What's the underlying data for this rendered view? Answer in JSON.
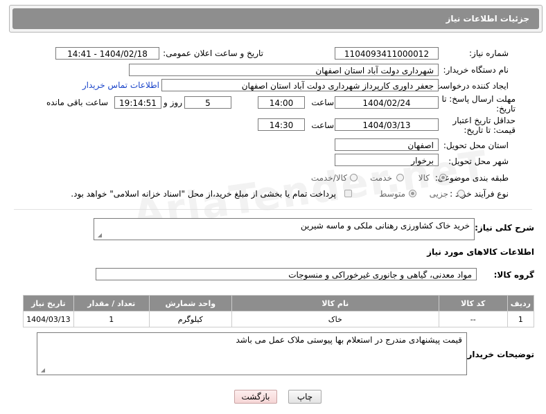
{
  "header": {
    "title": "جزئیات اطلاعات نیاز"
  },
  "watermark": "AriaTender.neT",
  "form": {
    "need_number_label": "شماره نیاز:",
    "need_number": "1104093411000012",
    "announce_label": "تاریخ و ساعت اعلان عمومی:",
    "announce_value": "1404/02/18 - 14:41",
    "buyer_org_label": "نام دستگاه خریدار:",
    "buyer_org": "شهرداری دولت آباد استان اصفهان",
    "creator_label": "ایجاد کننده درخواست:",
    "creator": "جعفر داوری کارپرداز شهرداری دولت آباد استان اصفهان",
    "contact_link": "اطلاعات تماس خریدار",
    "deadline_label": "مهلت ارسال پاسخ: تا تاریخ:",
    "deadline_date": "1404/02/24",
    "time_label": "ساعت",
    "deadline_time": "14:00",
    "days_value": "5",
    "days_label": "روز و",
    "remaining_time": "19:14:51",
    "remaining_label": "ساعت باقی مانده",
    "validity_label": "حداقل تاریخ اعتبار قیمت: تا تاریخ:",
    "validity_date": "1404/03/13",
    "validity_time": "14:30",
    "delivery_province_label": "استان محل تحویل:",
    "delivery_province": "اصفهان",
    "delivery_city_label": "شهر محل تحویل:",
    "delivery_city": "برخوار",
    "category_label": "طبقه بندی موضوعی:",
    "category_options": [
      "کالا",
      "خدمت",
      "کالا/خدمت"
    ],
    "process_label": "نوع فرآیند خرید :",
    "process_options": [
      "جزیی",
      "متوسط"
    ],
    "payment_note": "پرداخت تمام یا بخشی از مبلغ خرید،از محل \"اسناد خزانه اسلامی\" خواهد بود."
  },
  "description": {
    "label": "شرح کلی نیاز:",
    "value": "خرید خاک کشاورزی رهنانی ملکی و ماسه شیرین"
  },
  "goods": {
    "section_title": "اطلاعات کالاهای مورد نیاز",
    "group_label": "گروه کالا:",
    "group_value": "مواد معدنی، گیاهی و جانوری غیرخوراکی و منسوجات",
    "columns": [
      "ردیف",
      "کد کالا",
      "نام کالا",
      "واحد شمارش",
      "تعداد / مقدار",
      "تاریخ نیاز"
    ],
    "rows": [
      [
        "1",
        "--",
        "خاک",
        "کیلوگرم",
        "1",
        "1404/03/13"
      ]
    ]
  },
  "buyer_notes": {
    "label": "توضیحات خریدار:",
    "value": "قیمت پیشنهادی مندرج در استعلام بها پیوستی ملاک عمل می باشد"
  },
  "buttons": {
    "print": "چاپ",
    "back": "بازگشت"
  }
}
